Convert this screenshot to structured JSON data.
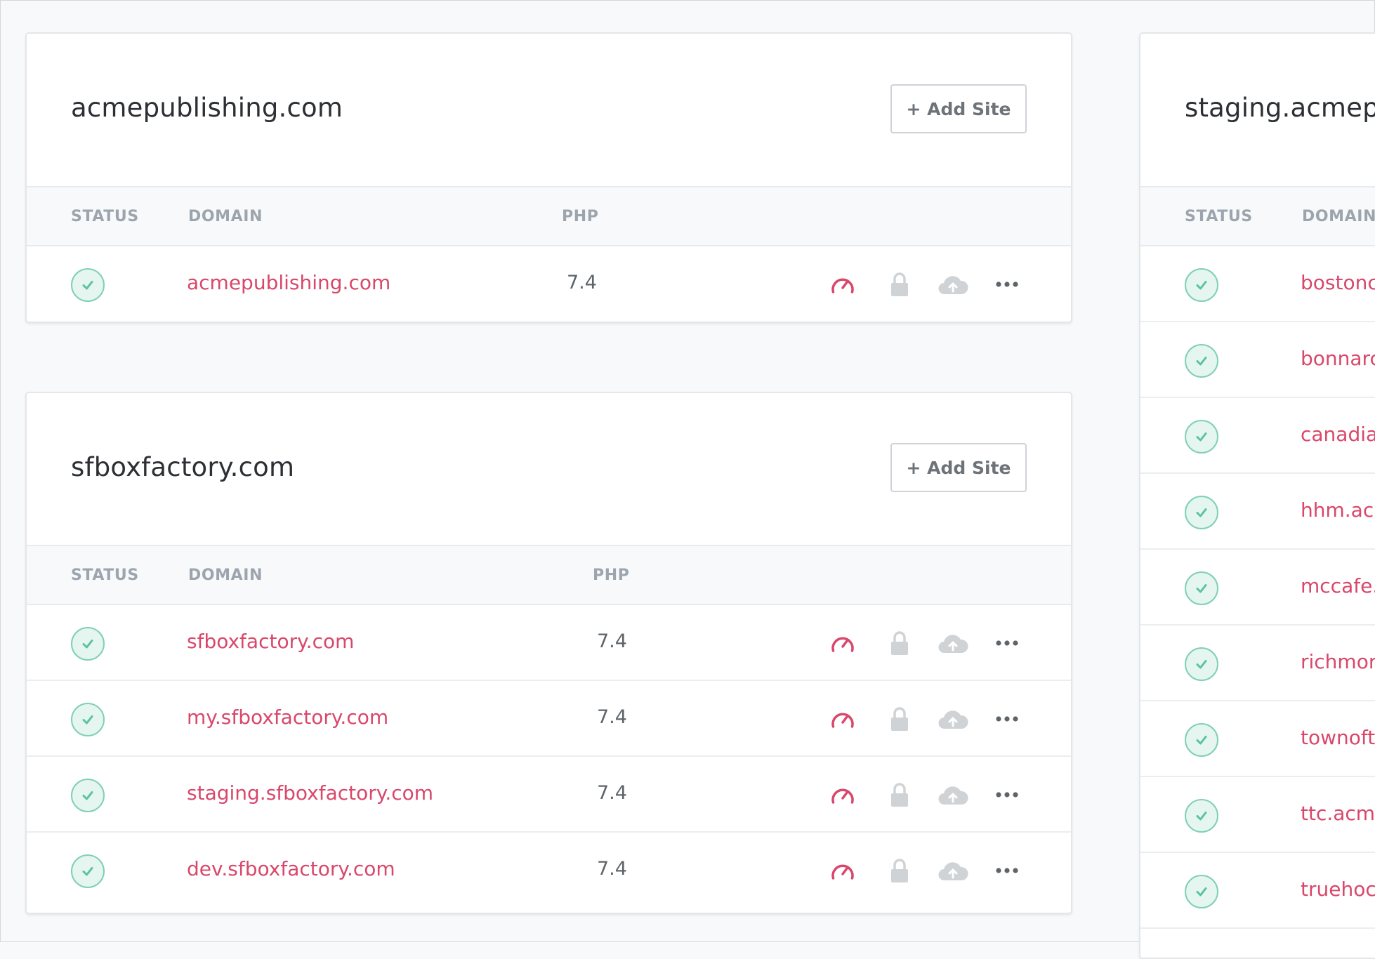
{
  "colors": {
    "domain_link": "#d9476a",
    "status_ok": "#5cc29f",
    "speed_icon": "#d9476a",
    "muted_icon": "#d0d3d6"
  },
  "table_headers": {
    "status": "STATUS",
    "domain": "DOMAIN",
    "php": "PHP"
  },
  "groups": [
    {
      "name": "acmepublishing.com",
      "add_label": "+ Add Site",
      "sites": [
        {
          "domain": "acmepublishing.com",
          "php": "7.4",
          "status": "ok"
        }
      ]
    },
    {
      "name": "sfboxfactory.com",
      "add_label": "+ Add Site",
      "sites": [
        {
          "domain": "sfboxfactory.com",
          "php": "7.4",
          "status": "ok"
        },
        {
          "domain": "my.sfboxfactory.com",
          "php": "7.4",
          "status": "ok"
        },
        {
          "domain": "staging.sfboxfactory.com",
          "php": "7.4",
          "status": "ok"
        },
        {
          "domain": "dev.sfboxfactory.com",
          "php": "7.4",
          "status": "ok"
        }
      ]
    },
    {
      "name": "staging.acmepu",
      "sites": [
        {
          "domain": "bostonc",
          "status": "ok"
        },
        {
          "domain": "bonnarc",
          "status": "ok"
        },
        {
          "domain": "canadia",
          "status": "ok"
        },
        {
          "domain": "hhm.acr",
          "status": "ok"
        },
        {
          "domain": "mccafe.",
          "status": "ok"
        },
        {
          "domain": "richmor",
          "status": "ok"
        },
        {
          "domain": "townoft",
          "status": "ok"
        },
        {
          "domain": "ttc.acme",
          "status": "ok"
        },
        {
          "domain": "truehoc",
          "status": "ok"
        }
      ]
    }
  ]
}
